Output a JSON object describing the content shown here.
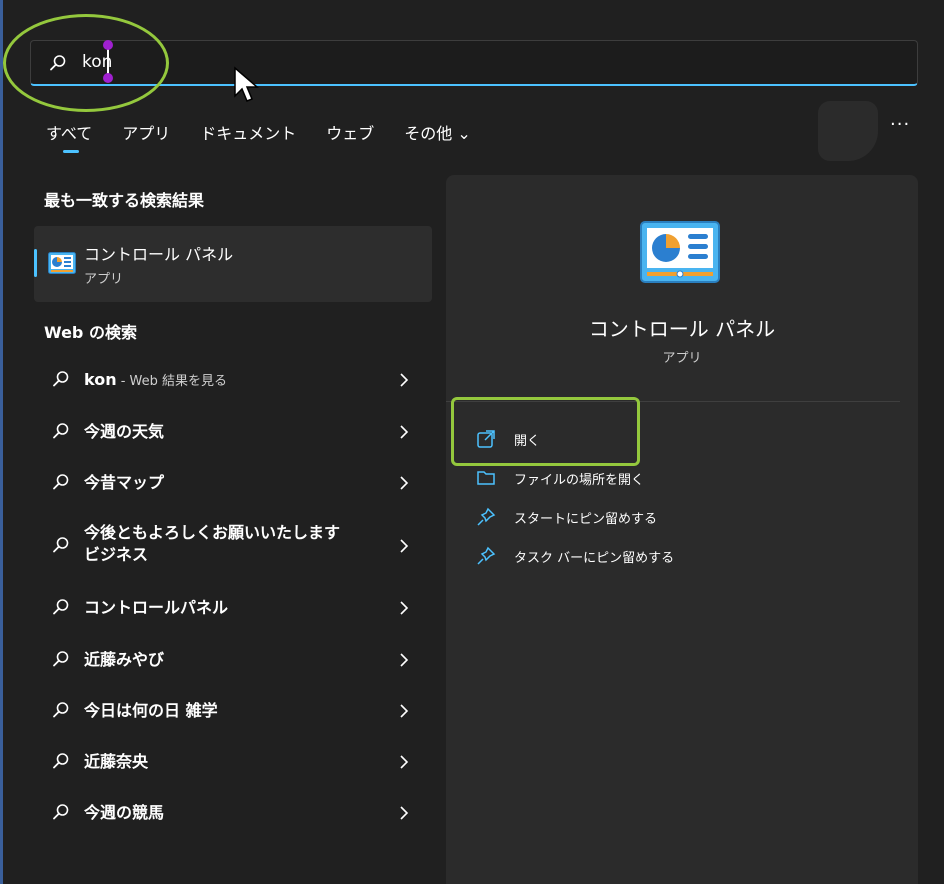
{
  "search": {
    "query": "kon"
  },
  "tabs": [
    "すべて",
    "アプリ",
    "ドキュメント",
    "ウェブ",
    "その他 ⌄"
  ],
  "more_label": "···",
  "best_match": {
    "heading": "最も一致する検索結果",
    "title": "コントロール パネル",
    "subtitle": "アプリ"
  },
  "web_search": {
    "heading": "Web の検索",
    "items": [
      {
        "label": "kon",
        "suffix": " - Web 結果を見る"
      },
      {
        "label": "今週の天気"
      },
      {
        "label": "今昔マップ"
      },
      {
        "label": "今後ともよろしくお願いいたします ビジネス"
      },
      {
        "label": "コントロールパネル"
      },
      {
        "label": "近藤みやび"
      },
      {
        "label": "今日は何の日 雑学"
      },
      {
        "label": "近藤奈央"
      },
      {
        "label": "今週の競馬"
      }
    ]
  },
  "details": {
    "title": "コントロール パネル",
    "subtitle": "アプリ",
    "actions": [
      {
        "label": "開く",
        "icon": "open-external-icon"
      },
      {
        "label": "ファイルの場所を開く",
        "icon": "folder-icon"
      },
      {
        "label": "スタートにピン留めする",
        "icon": "pin-icon"
      },
      {
        "label": "タスク バーにピン留めする",
        "icon": "pin-icon"
      }
    ]
  },
  "colors": {
    "accent": "#4cc2ff",
    "highlight": "#94c83d",
    "background": "#202020",
    "panel": "#2b2b2b"
  }
}
